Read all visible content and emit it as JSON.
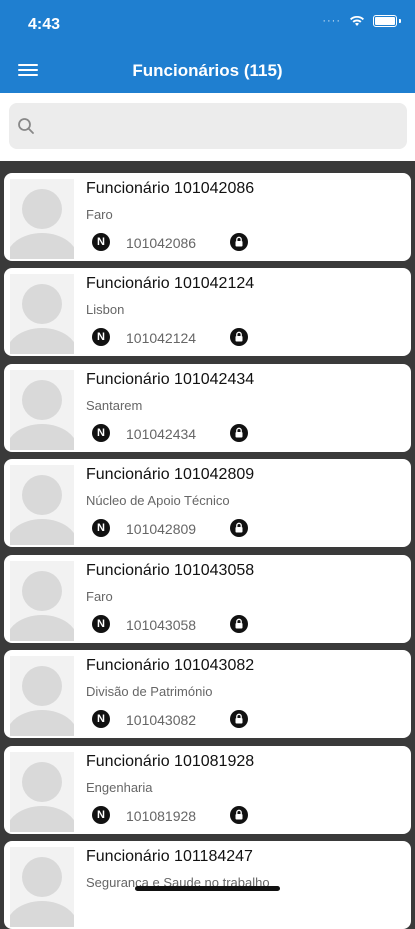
{
  "status": {
    "time": "4:43"
  },
  "header": {
    "title": "Funcionários (115)",
    "menu_icon": "hamburger-icon"
  },
  "search": {
    "placeholder": "",
    "value": ""
  },
  "employees": [
    {
      "name": "Funcionário 101042086",
      "department": "Faro",
      "number": "101042086"
    },
    {
      "name": "Funcionário 101042124",
      "department": "Lisbon",
      "number": "101042124"
    },
    {
      "name": "Funcionário 101042434",
      "department": "Santarem",
      "number": "101042434"
    },
    {
      "name": "Funcionário 101042809",
      "department": "Núcleo de Apoio Técnico",
      "number": "101042809"
    },
    {
      "name": "Funcionário 101043058",
      "department": "Faro",
      "number": "101043058"
    },
    {
      "name": "Funcionário 101043082",
      "department": "Divisão de Património",
      "number": "101043082"
    },
    {
      "name": "Funcionário 101081928",
      "department": "Engenharia",
      "number": "101081928"
    },
    {
      "name": "Funcionário 101184247",
      "department": "Segurança e Saude no trabalho",
      "number": ""
    }
  ],
  "badge_label": "N",
  "colors": {
    "header": "#1f7fd0",
    "list_bg": "#3a3a3a",
    "card": "#ffffff"
  }
}
